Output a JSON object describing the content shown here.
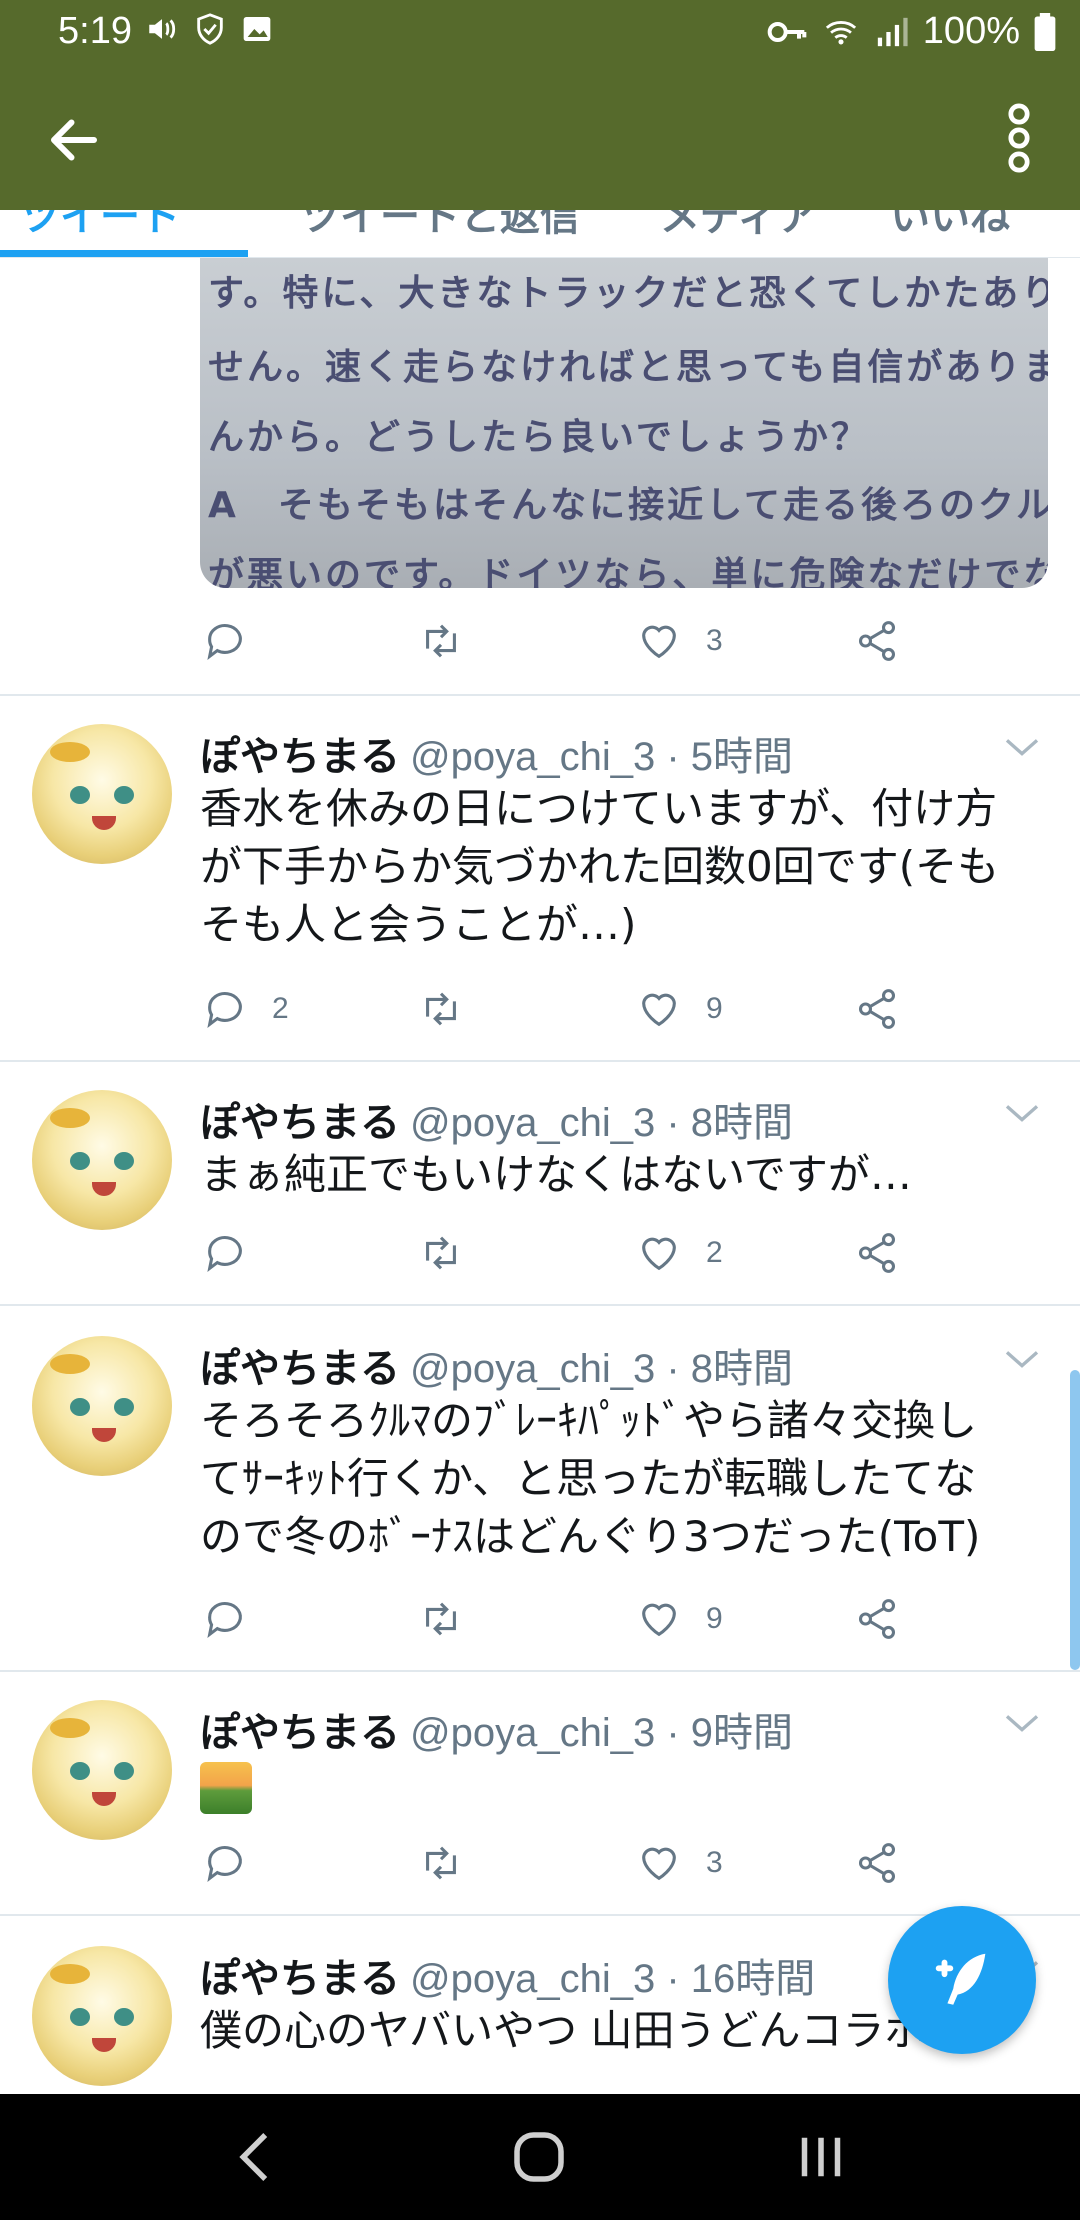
{
  "status_bar": {
    "time": "5:19",
    "battery": "100%",
    "icons_left": [
      "volume-icon",
      "shield-check-icon",
      "image-icon"
    ],
    "icons_right": [
      "key-icon",
      "wifi-icon",
      "signal-icon",
      "battery-icon"
    ]
  },
  "app_bar": {
    "back_icon": "arrow-left-icon",
    "menu_icon": "more-vert-icon",
    "color": "#566a2c"
  },
  "tabs": {
    "accent": "#1da1f2",
    "items": [
      "ツイート",
      "ツイートと返信",
      "メディア",
      "いいね"
    ]
  },
  "media_tweet": {
    "image_text": [
      "す。特に、大きなトラックだと恐くてしかたありま",
      "せん。速く走らなければと思っても自信がありませ",
      "んから。どうしたら良いでしょうか？",
      "A　そもそもはそんなに接近して走る後ろのクルマ",
      "が悪いのです。ドイツなら、単に危険なだけでなく"
    ],
    "likes": "3"
  },
  "tweets": [
    {
      "name": "ぽやちまる",
      "meta": "@poya_chi_3 · 5時間",
      "lines": [
        "香水を休みの日につけていますが、付け方",
        "が下手からか気づかれた回数0回です(そも",
        "そも人と会うことが…)"
      ],
      "replies": "2",
      "likes": "9"
    },
    {
      "name": "ぽやちまる",
      "meta": "@poya_chi_3 · 8時間",
      "lines": [
        "まぁ純正でもいけなくはないですが…"
      ],
      "replies": "",
      "likes": "2"
    },
    {
      "name": "ぽやちまる",
      "meta": "@poya_chi_3 · 8時間",
      "lines": [
        "そろそろｸﾙﾏのﾌﾞﾚｰｷﾊﾟｯﾄﾞやら諸々交換し",
        "てｻｰｷｯﾄ行くか、と思ったが転職したてな",
        "ので冬のﾎﾞｰﾅｽはどんぐり3つだった(ToT)"
      ],
      "replies": "",
      "likes": "9"
    },
    {
      "name": "ぽやちまる",
      "meta": "@poya_chi_3 · 9時間",
      "lines": [],
      "emoji": "sunrise-over-mountains-icon",
      "replies": "",
      "likes": "3"
    },
    {
      "name": "ぽやちまる",
      "meta": "@poya_chi_3 · 16時間",
      "lines": [
        "僕の心のヤバいやつ 山田うどんコラボ"
      ],
      "replies": "",
      "likes": ""
    }
  ],
  "fab": {
    "icon": "compose-tweet-icon",
    "color": "#1da1f2"
  },
  "nav_bar": {
    "icons": [
      "back-nav-icon",
      "home-nav-icon",
      "recents-nav-icon"
    ]
  }
}
